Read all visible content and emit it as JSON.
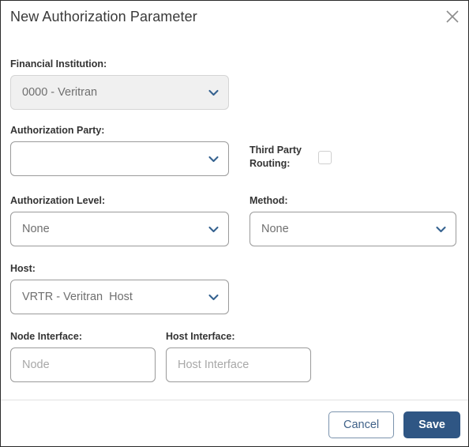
{
  "dialog": {
    "title": "New Authorization Parameter",
    "close_icon": "close-icon"
  },
  "colors": {
    "accent_navy": "#2f5684",
    "cancel_border": "#7b93ad",
    "chevron": "#34618f",
    "label_text": "#333333",
    "placeholder_text": "#a8a8a8",
    "disabled_bg": "#f0f0f0",
    "dialog_border": "#2b2b2b"
  },
  "form": {
    "financial_institution": {
      "label": "Financial Institution:",
      "value": "0000 - Veritran",
      "disabled": true,
      "icon": "chevron-down-icon"
    },
    "authorization_party": {
      "label": "Authorization Party:",
      "value": "",
      "disabled": false,
      "icon": "chevron-down-icon"
    },
    "third_party_routing": {
      "label": "Third Party Routing:",
      "checked": false
    },
    "authorization_level": {
      "label": "Authorization Level:",
      "value": "None",
      "disabled": false,
      "icon": "chevron-down-icon"
    },
    "method": {
      "label": "Method:",
      "value": "None",
      "disabled": false,
      "icon": "chevron-down-icon"
    },
    "host": {
      "label": "Host:",
      "value": "VRTR - Veritran  Host",
      "disabled": false,
      "icon": "chevron-down-icon"
    },
    "node_interface": {
      "label": "Node Interface:",
      "value": "",
      "placeholder": "Node"
    },
    "host_interface": {
      "label": "Host Interface:",
      "value": "",
      "placeholder": "Host Interface"
    }
  },
  "footer": {
    "cancel_label": "Cancel",
    "save_label": "Save"
  }
}
